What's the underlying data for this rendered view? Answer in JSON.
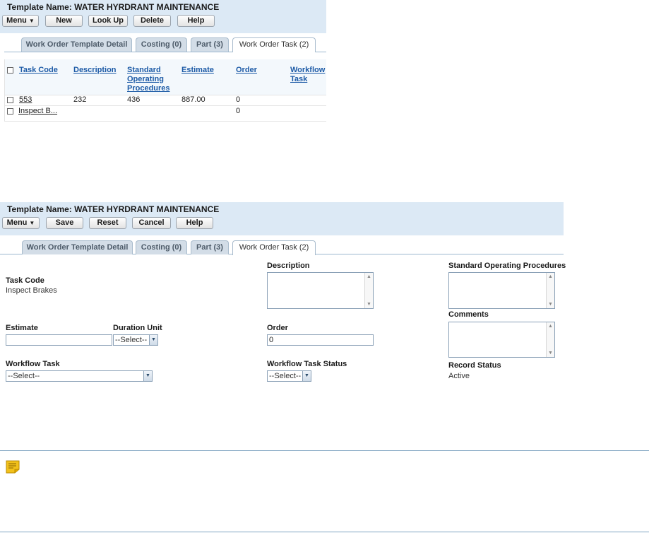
{
  "panel1": {
    "template_title": "Template Name: WATER HYRDRANT MAINTENANCE",
    "toolbar": {
      "menu": "Menu",
      "new": "New",
      "lookup": "Look Up",
      "delete": "Delete",
      "help": "Help"
    },
    "tabs": [
      "Work Order Template Detail",
      "Costing (0)",
      "Part (3)",
      "Work Order Task (2)"
    ],
    "grid": {
      "columns": [
        "Task Code",
        "Description",
        "Standard Operating Procedures",
        "Estimate",
        "Order",
        "Workflow Task"
      ],
      "rows": [
        {
          "task_code": "553",
          "description": "232",
          "sop": "436",
          "estimate": "887.00",
          "order": "0"
        },
        {
          "task_code": "Inspect B...",
          "description": "",
          "sop": "",
          "estimate": "",
          "order": "0"
        }
      ]
    }
  },
  "panel2": {
    "template_title": "Template Name: WATER HYRDRANT MAINTENANCE",
    "toolbar": {
      "menu": "Menu",
      "save": "Save",
      "reset": "Reset",
      "cancel": "Cancel",
      "help": "Help"
    },
    "tabs": [
      "Work Order Template Detail",
      "Costing (0)",
      "Part (3)",
      "Work Order Task (2)"
    ],
    "form": {
      "task_code_label": "Task Code",
      "task_code_value": "Inspect Brakes",
      "description_label": "Description",
      "sop_label": "Standard Operating Procedures",
      "comments_label": "Comments",
      "estimate_label": "Estimate",
      "estimate_value": "",
      "duration_unit_label": "Duration Unit",
      "duration_unit_value": "--Select--",
      "order_label": "Order",
      "order_value": "0",
      "workflow_task_label": "Workflow Task",
      "workflow_task_value": "--Select--",
      "workflow_task_status_label": "Workflow Task Status",
      "workflow_task_status_value": "--Select--",
      "record_status_label": "Record Status",
      "record_status_value": "Active"
    }
  },
  "icons": {
    "notes": "note-icon"
  },
  "colors": {
    "header_bg": "#dce9f5",
    "link": "#1c5aa6",
    "tab_bg": "#d3dde7",
    "note_icon": "#f2c11b"
  }
}
